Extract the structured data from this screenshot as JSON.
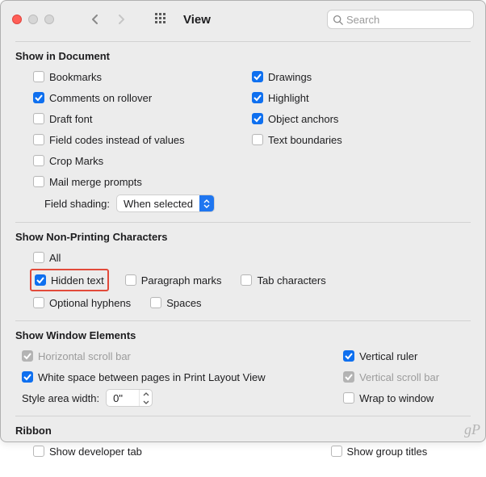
{
  "titlebar": {
    "title": "View",
    "search_placeholder": "Search"
  },
  "sections": {
    "show_in_document": {
      "title": "Show in Document",
      "left": {
        "bookmarks": "Bookmarks",
        "comments": "Comments on rollover",
        "draft_font": "Draft font",
        "field_codes": "Field codes instead of values",
        "crop_marks": "Crop Marks",
        "mail_merge": "Mail merge prompts"
      },
      "right": {
        "drawings": "Drawings",
        "highlight": "Highlight",
        "object_anchors": "Object anchors",
        "text_boundaries": "Text boundaries"
      },
      "field_shading_label": "Field shading:",
      "field_shading_value": "When selected"
    },
    "non_printing": {
      "title": "Show Non-Printing Characters",
      "all": "All",
      "hidden_text": "Hidden text",
      "paragraph_marks": "Paragraph marks",
      "tab_characters": "Tab characters",
      "optional_hyphens": "Optional hyphens",
      "spaces": "Spaces"
    },
    "window_elements": {
      "title": "Show Window Elements",
      "horizontal_scroll": "Horizontal scroll bar",
      "white_space": "White space between pages in Print Layout View",
      "style_area_label": "Style area width:",
      "style_area_value": "0\"",
      "vertical_ruler": "Vertical ruler",
      "vertical_scroll": "Vertical scroll bar",
      "wrap_to_window": "Wrap to window"
    },
    "ribbon": {
      "title": "Ribbon",
      "developer": "Show developer tab",
      "group_titles": "Show group titles"
    }
  },
  "watermark": "gP"
}
